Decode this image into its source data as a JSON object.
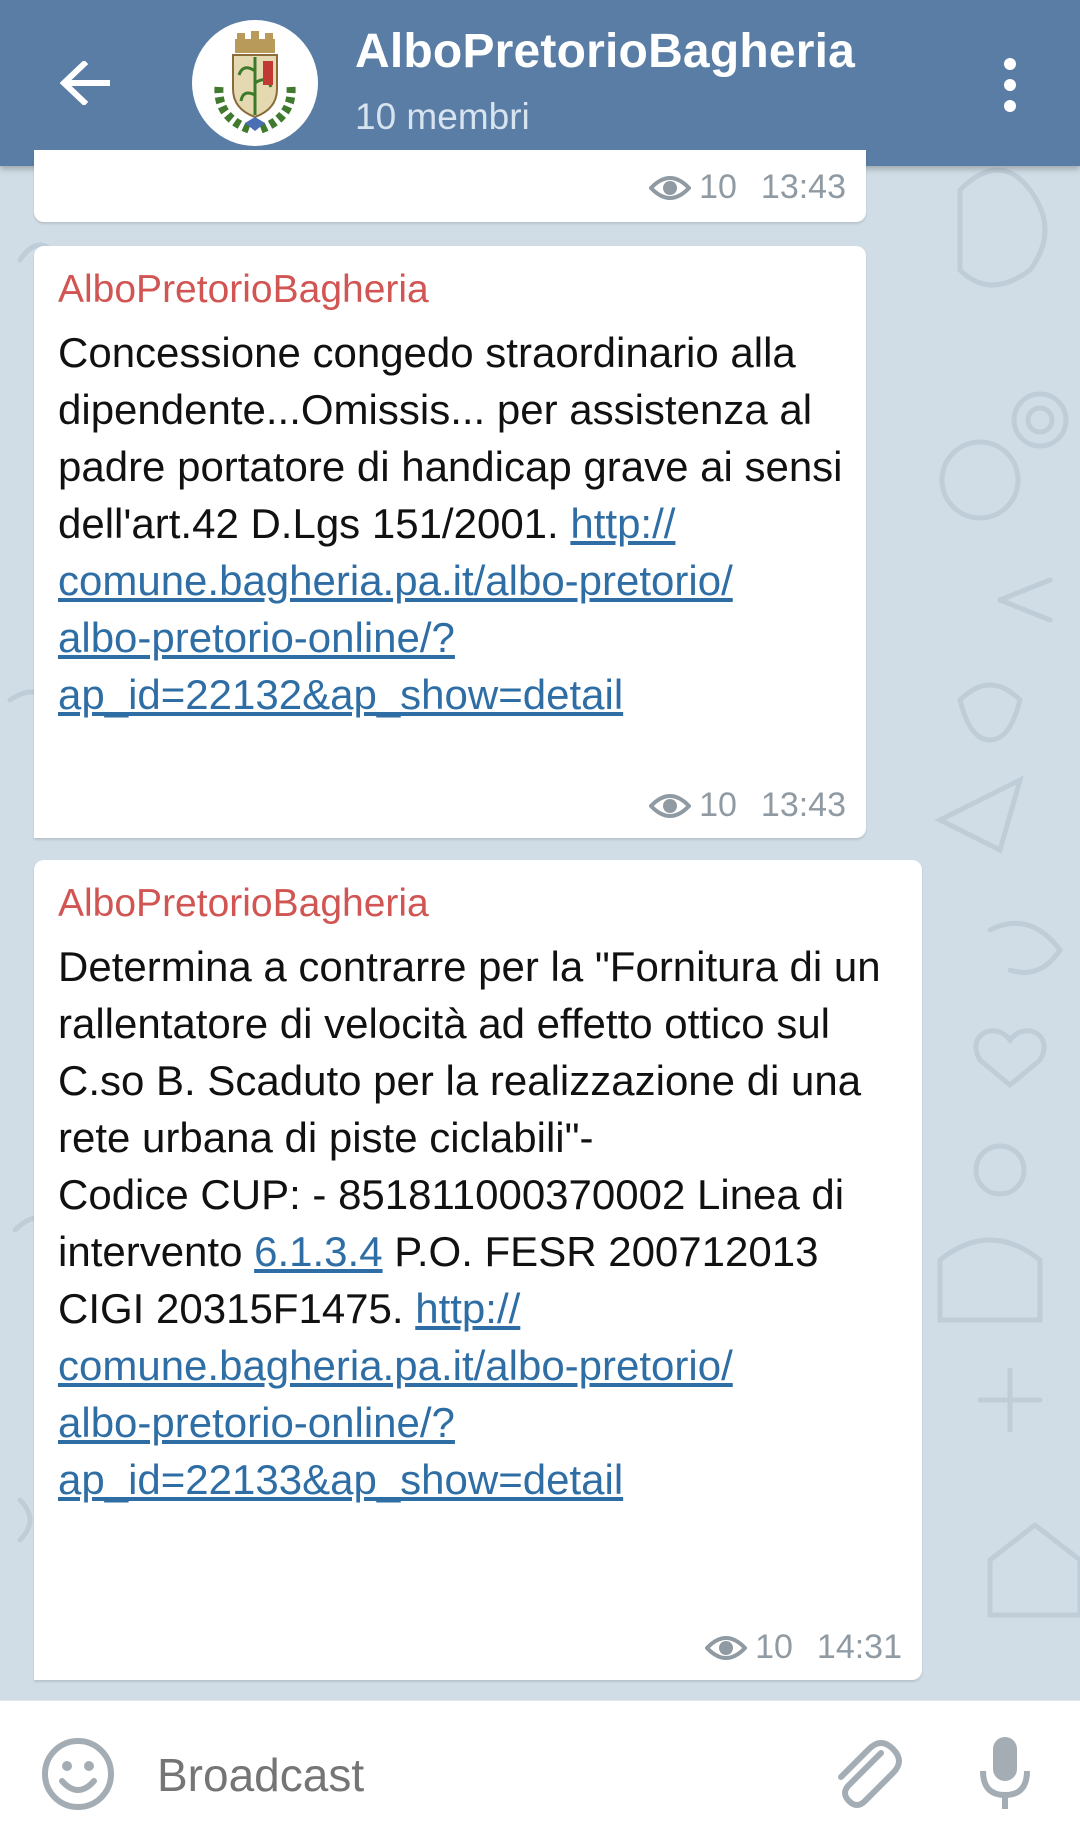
{
  "header": {
    "title": "AlboPretorioBagheria",
    "subtitle": "10 membri"
  },
  "messages": [
    {
      "views": "10",
      "time": "13:43"
    },
    {
      "sender": "AlboPretorioBagheria",
      "text": "Concessione congedo straordinario alla dipendente...Omissis... per assistenza al padre portatore di handicap grave ai sensi dell'art.42 D.Lgs 151/2001.",
      "link_line1": "http://",
      "link_line2": "comune.bagheria.pa.it/albo-pretorio/",
      "link_line3": "albo-pretorio-online/?",
      "link_line4": "ap_id=22132&ap_show=detail",
      "views": "10",
      "time": "13:43"
    },
    {
      "sender": "AlboPretorioBagheria",
      "text_part1": "Determina a contrarre per la \"Fornitura di un rallentatore di velocità ad effetto ottico sul C.so B. Scaduto per la realizzazione di una rete urbana di piste ciclabili\"-",
      "text_part2": "Codice CUP: - 851811000370002 Linea di intervento",
      "inline_link": "6.1.3.4",
      "text_part3": "P.O. FESR 200712013",
      "text_part4": "CIGI 20315F1475.",
      "link_line1": "http://",
      "link_line2": "comune.bagheria.pa.it/albo-pretorio/",
      "link_line3": "albo-pretorio-online/?",
      "link_line4": "ap_id=22133&ap_show=detail",
      "views": "10",
      "time": "14:31"
    }
  ],
  "composer": {
    "placeholder": "Broadcast"
  },
  "colors": {
    "header": "#5a7da6",
    "sender": "#d15553",
    "link": "#2f6ea5",
    "meta": "#8f9aa3",
    "chat_background": "#d1dde6"
  }
}
